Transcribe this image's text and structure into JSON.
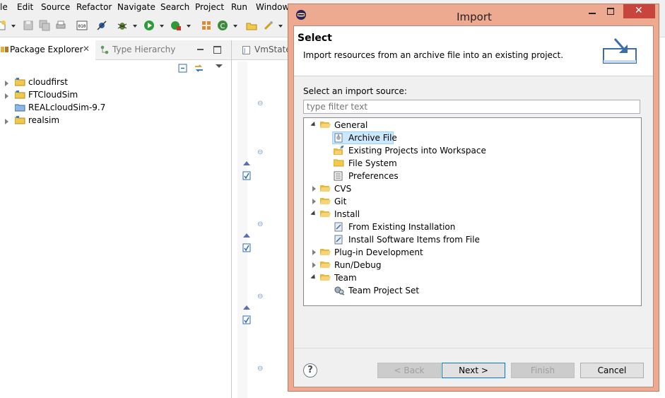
{
  "menu": [
    "le",
    "Edit",
    "Source",
    "Refactor",
    "Navigate",
    "Search",
    "Project",
    "Run",
    "Window"
  ],
  "left_panel": {
    "tabs": {
      "package_explorer": "Package Explorer",
      "type_hierarchy": "Type Hierarchy"
    },
    "projects": [
      "cloudfirst",
      "FTCloudSim",
      "REALcloudSim-9.7",
      "realsim"
    ]
  },
  "editor": {
    "tab_label": "VmState"
  },
  "dialog": {
    "title": "Import",
    "header_title": "Select",
    "header_description": "Import resources from an archive file into an existing project.",
    "source_label": "Select an import source:",
    "filter_placeholder": "type filter text",
    "tree": {
      "general": "General",
      "archive_file": "Archive File",
      "existing_projects": "Existing Projects into Workspace",
      "file_system": "File System",
      "preferences": "Preferences",
      "cvs": "CVS",
      "git": "Git",
      "install": "Install",
      "from_existing_installation": "From Existing Installation",
      "install_software_items": "Install Software Items from File",
      "plugin_development": "Plug-in Development",
      "run_debug": "Run/Debug",
      "team": "Team",
      "team_project_set": "Team Project Set"
    },
    "buttons": {
      "help": "?",
      "back": "< Back",
      "next": "Next >",
      "finish": "Finish",
      "cancel": "Cancel"
    }
  },
  "colors": {
    "dialog_frame": "#eeaa90",
    "selection": "#cce8ff",
    "close_button": "#c7453c"
  }
}
